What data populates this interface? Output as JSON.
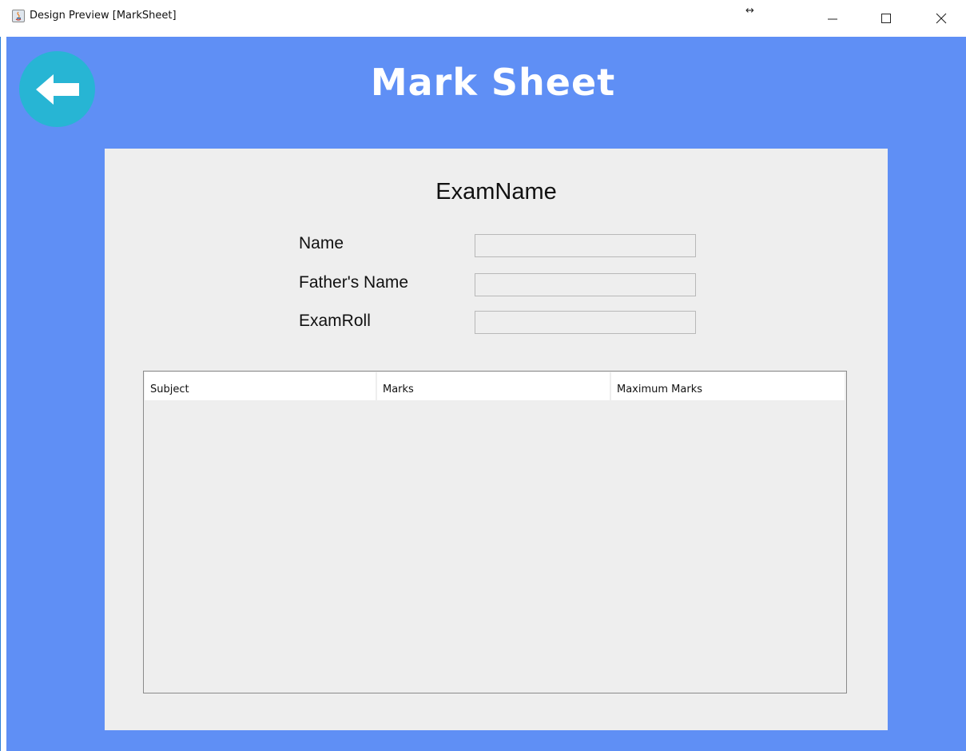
{
  "window": {
    "title": "Design Preview [MarkSheet]",
    "resize_glyph": "↔",
    "controls": [
      "minimize",
      "maximize",
      "close"
    ]
  },
  "header": {
    "title": "Mark Sheet",
    "back_icon": "arrow-left-icon"
  },
  "panel": {
    "exam_name": "ExamName",
    "fields": {
      "name_label": "Name",
      "name_value": "",
      "father_label": "Father's Name",
      "father_value": "",
      "roll_label": "ExamRoll",
      "roll_value": ""
    }
  },
  "table": {
    "columns": [
      "Subject",
      "Marks",
      "Maximum Marks"
    ],
    "rows": []
  },
  "colors": {
    "background": "#5f8ff5",
    "back_button": "#27b5d4",
    "panel": "#eeeeee"
  }
}
